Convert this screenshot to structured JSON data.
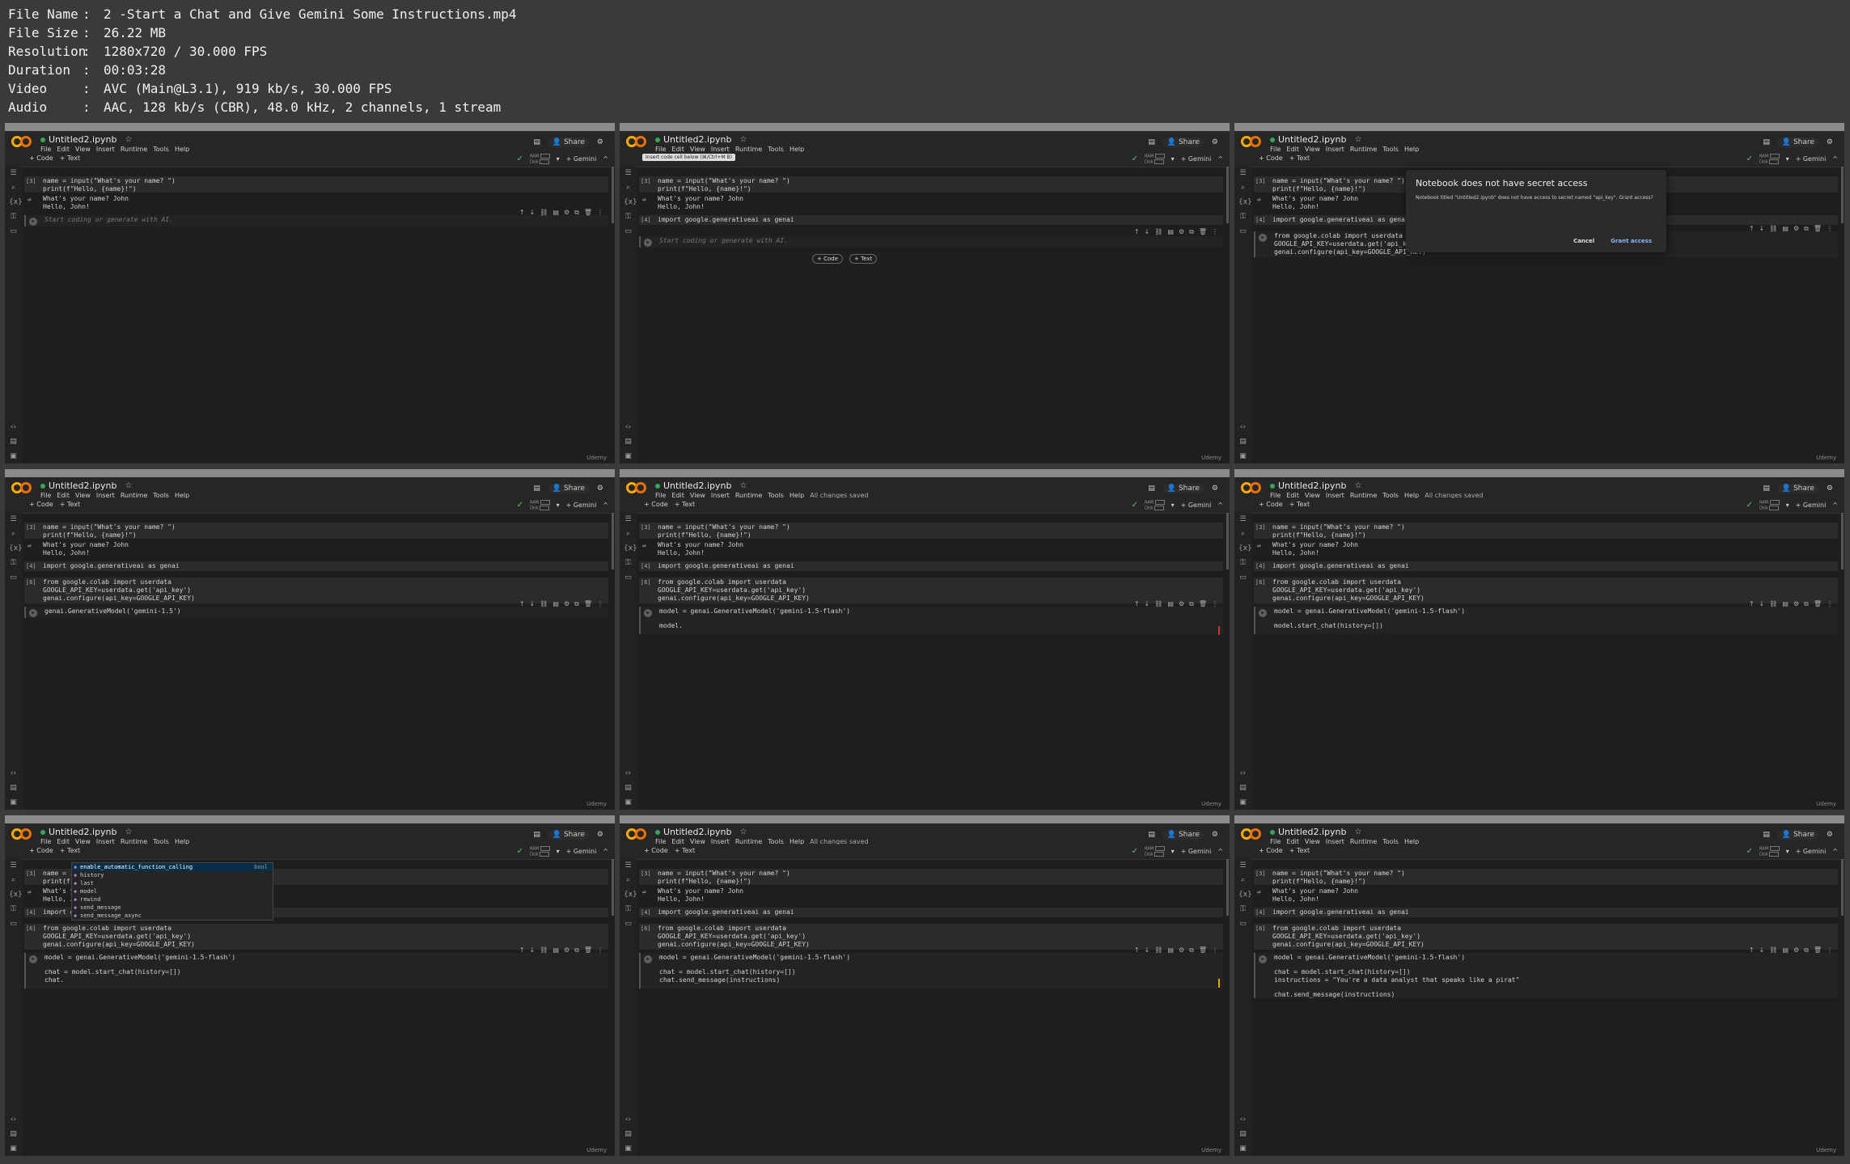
{
  "info": [
    {
      "key": "File Name",
      "value": "2 -Start a Chat and Give Gemini Some Instructions.mp4"
    },
    {
      "key": "File Size",
      "value": "26.22 MB"
    },
    {
      "key": "Resolution",
      "value": "1280x720 / 30.000 FPS"
    },
    {
      "key": "Duration",
      "value": "00:03:28"
    },
    {
      "key": "Video",
      "value": "AVC (Main@L3.1), 919 kb/s, 30.000 FPS"
    },
    {
      "key": "Audio",
      "value": "AAC, 128 kb/s (CBR), 48.0 kHz, 2 channels, 1 stream"
    }
  ],
  "colab": {
    "title": "Untitled2.ipynb",
    "menus": [
      "File",
      "Edit",
      "View",
      "Insert",
      "Runtime",
      "Tools",
      "Help"
    ],
    "saved": "All changes saved",
    "share": "Share",
    "add_code": "+ Code",
    "add_text": "+ Text",
    "ram": "RAM",
    "disk": "Disk",
    "gemini": "+ Gemini",
    "watermark": "Udemy",
    "placeholder": "Start coding or generate with AI.",
    "tooltip": "Insert code cell below (⌘/Ctrl+M B)",
    "cell3_line1": "name = input(\"What's your name? \")",
    "cell3_line2": "print(f\"Hello, {name}!\")",
    "out_line1": "What's your name? John",
    "out_line2": "Hello, John!",
    "cell4": "import google.generativeai as genai",
    "cell6_line1": "from google.colab import userdata",
    "cell6_line2": "GOOGLE_API_KEY=userdata.get('api_key')",
    "cell6_line3": "genai.configure(api_key=GOOGLE_API_KEY)",
    "exec3": "[3]",
    "exec4": "[4]",
    "exec6": "[6]",
    "model_15": "genai.GenerativeModel('gemini-1.5')",
    "model_line": "model = genai.GenerativeModel('gemini-1.5-flash')",
    "model_partial": "model.",
    "model_start_chat": "model.start_chat(history=[])",
    "chat_line": "chat = model.start_chat(history=[])",
    "chat_dot": "chat.",
    "send_msg": "chat.send_message(instructions)",
    "instructions": "instructions = \"You're a data analyst that speaks like a pirat\""
  },
  "dialog": {
    "title": "Notebook does not have secret access",
    "body": "Notebook titled \"Untitled2.ipynb\" does not have access to secret named \"api_key\". Grant access?",
    "cancel": "Cancel",
    "grant": "Grant access"
  },
  "autocomplete": {
    "items": [
      "enable_automatic_function_calling",
      "history",
      "last",
      "model",
      "rewind",
      "send_message",
      "send_message_async"
    ],
    "selected_type": "bool"
  }
}
